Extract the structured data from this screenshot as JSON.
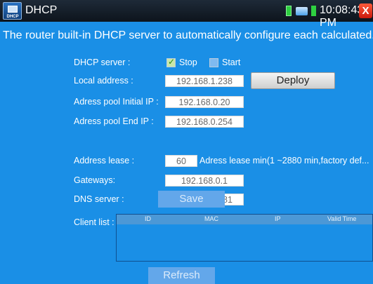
{
  "app": {
    "title": "DHCP",
    "icon_caption": "DHCP",
    "clock": "10:08:43 PM",
    "close_glyph": "X"
  },
  "headline": "The router built-in DHCP server to automatically configure each calculated...",
  "form": {
    "dhcp_server": {
      "label": "DHCP server :",
      "stop_label": "Stop",
      "start_label": "Start",
      "stop_checked": true,
      "start_checked": false
    },
    "local_address": {
      "label": "Local address :",
      "value": "192.168.1.238"
    },
    "deploy_label": "Deploy",
    "pool_initial": {
      "label": "Adress pool Initial IP :",
      "value": "192.168.0.20"
    },
    "pool_end": {
      "label": "Adress pool End IP :",
      "value": "192.168.0.254"
    },
    "lease": {
      "label": "Address lease :",
      "value": "60",
      "note": "Adress lease min(1 ~2880 min,factory def..."
    },
    "gateways": {
      "label": "Gateways:",
      "value": "192.168.0.1"
    },
    "dns": {
      "label": "DNS server :",
      "value": "129.219.13.81"
    },
    "save_label": "Save"
  },
  "client_list": {
    "label": "Client list :",
    "columns": [
      "ID",
      "MAC",
      "IP",
      "Valid Time"
    ],
    "rows": []
  },
  "refresh_label": "Refresh",
  "colors": {
    "background": "#1a8fe6",
    "titlebar": "#0d141c",
    "close": "#d8230f",
    "field": "#ffffff"
  }
}
